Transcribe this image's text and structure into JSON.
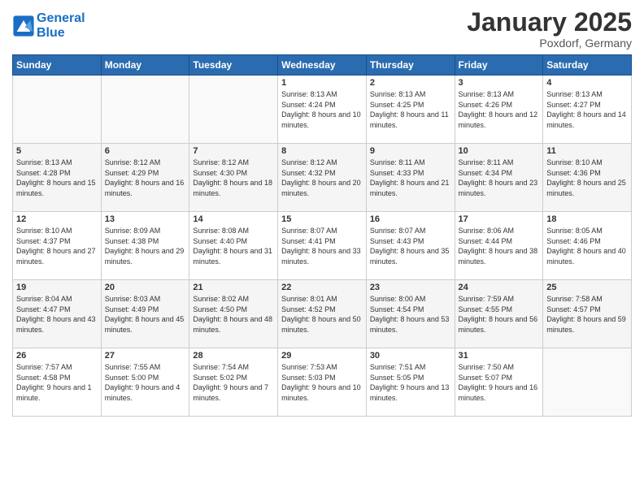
{
  "header": {
    "logo_line1": "General",
    "logo_line2": "Blue",
    "month_title": "January 2025",
    "location": "Poxdorf, Germany"
  },
  "weekdays": [
    "Sunday",
    "Monday",
    "Tuesday",
    "Wednesday",
    "Thursday",
    "Friday",
    "Saturday"
  ],
  "weeks": [
    [
      {
        "day": "",
        "sunrise": "",
        "sunset": "",
        "daylight": ""
      },
      {
        "day": "",
        "sunrise": "",
        "sunset": "",
        "daylight": ""
      },
      {
        "day": "",
        "sunrise": "",
        "sunset": "",
        "daylight": ""
      },
      {
        "day": "1",
        "sunrise": "Sunrise: 8:13 AM",
        "sunset": "Sunset: 4:24 PM",
        "daylight": "Daylight: 8 hours and 10 minutes."
      },
      {
        "day": "2",
        "sunrise": "Sunrise: 8:13 AM",
        "sunset": "Sunset: 4:25 PM",
        "daylight": "Daylight: 8 hours and 11 minutes."
      },
      {
        "day": "3",
        "sunrise": "Sunrise: 8:13 AM",
        "sunset": "Sunset: 4:26 PM",
        "daylight": "Daylight: 8 hours and 12 minutes."
      },
      {
        "day": "4",
        "sunrise": "Sunrise: 8:13 AM",
        "sunset": "Sunset: 4:27 PM",
        "daylight": "Daylight: 8 hours and 14 minutes."
      }
    ],
    [
      {
        "day": "5",
        "sunrise": "Sunrise: 8:13 AM",
        "sunset": "Sunset: 4:28 PM",
        "daylight": "Daylight: 8 hours and 15 minutes."
      },
      {
        "day": "6",
        "sunrise": "Sunrise: 8:12 AM",
        "sunset": "Sunset: 4:29 PM",
        "daylight": "Daylight: 8 hours and 16 minutes."
      },
      {
        "day": "7",
        "sunrise": "Sunrise: 8:12 AM",
        "sunset": "Sunset: 4:30 PM",
        "daylight": "Daylight: 8 hours and 18 minutes."
      },
      {
        "day": "8",
        "sunrise": "Sunrise: 8:12 AM",
        "sunset": "Sunset: 4:32 PM",
        "daylight": "Daylight: 8 hours and 20 minutes."
      },
      {
        "day": "9",
        "sunrise": "Sunrise: 8:11 AM",
        "sunset": "Sunset: 4:33 PM",
        "daylight": "Daylight: 8 hours and 21 minutes."
      },
      {
        "day": "10",
        "sunrise": "Sunrise: 8:11 AM",
        "sunset": "Sunset: 4:34 PM",
        "daylight": "Daylight: 8 hours and 23 minutes."
      },
      {
        "day": "11",
        "sunrise": "Sunrise: 8:10 AM",
        "sunset": "Sunset: 4:36 PM",
        "daylight": "Daylight: 8 hours and 25 minutes."
      }
    ],
    [
      {
        "day": "12",
        "sunrise": "Sunrise: 8:10 AM",
        "sunset": "Sunset: 4:37 PM",
        "daylight": "Daylight: 8 hours and 27 minutes."
      },
      {
        "day": "13",
        "sunrise": "Sunrise: 8:09 AM",
        "sunset": "Sunset: 4:38 PM",
        "daylight": "Daylight: 8 hours and 29 minutes."
      },
      {
        "day": "14",
        "sunrise": "Sunrise: 8:08 AM",
        "sunset": "Sunset: 4:40 PM",
        "daylight": "Daylight: 8 hours and 31 minutes."
      },
      {
        "day": "15",
        "sunrise": "Sunrise: 8:07 AM",
        "sunset": "Sunset: 4:41 PM",
        "daylight": "Daylight: 8 hours and 33 minutes."
      },
      {
        "day": "16",
        "sunrise": "Sunrise: 8:07 AM",
        "sunset": "Sunset: 4:43 PM",
        "daylight": "Daylight: 8 hours and 35 minutes."
      },
      {
        "day": "17",
        "sunrise": "Sunrise: 8:06 AM",
        "sunset": "Sunset: 4:44 PM",
        "daylight": "Daylight: 8 hours and 38 minutes."
      },
      {
        "day": "18",
        "sunrise": "Sunrise: 8:05 AM",
        "sunset": "Sunset: 4:46 PM",
        "daylight": "Daylight: 8 hours and 40 minutes."
      }
    ],
    [
      {
        "day": "19",
        "sunrise": "Sunrise: 8:04 AM",
        "sunset": "Sunset: 4:47 PM",
        "daylight": "Daylight: 8 hours and 43 minutes."
      },
      {
        "day": "20",
        "sunrise": "Sunrise: 8:03 AM",
        "sunset": "Sunset: 4:49 PM",
        "daylight": "Daylight: 8 hours and 45 minutes."
      },
      {
        "day": "21",
        "sunrise": "Sunrise: 8:02 AM",
        "sunset": "Sunset: 4:50 PM",
        "daylight": "Daylight: 8 hours and 48 minutes."
      },
      {
        "day": "22",
        "sunrise": "Sunrise: 8:01 AM",
        "sunset": "Sunset: 4:52 PM",
        "daylight": "Daylight: 8 hours and 50 minutes."
      },
      {
        "day": "23",
        "sunrise": "Sunrise: 8:00 AM",
        "sunset": "Sunset: 4:54 PM",
        "daylight": "Daylight: 8 hours and 53 minutes."
      },
      {
        "day": "24",
        "sunrise": "Sunrise: 7:59 AM",
        "sunset": "Sunset: 4:55 PM",
        "daylight": "Daylight: 8 hours and 56 minutes."
      },
      {
        "day": "25",
        "sunrise": "Sunrise: 7:58 AM",
        "sunset": "Sunset: 4:57 PM",
        "daylight": "Daylight: 8 hours and 59 minutes."
      }
    ],
    [
      {
        "day": "26",
        "sunrise": "Sunrise: 7:57 AM",
        "sunset": "Sunset: 4:58 PM",
        "daylight": "Daylight: 9 hours and 1 minute."
      },
      {
        "day": "27",
        "sunrise": "Sunrise: 7:55 AM",
        "sunset": "Sunset: 5:00 PM",
        "daylight": "Daylight: 9 hours and 4 minutes."
      },
      {
        "day": "28",
        "sunrise": "Sunrise: 7:54 AM",
        "sunset": "Sunset: 5:02 PM",
        "daylight": "Daylight: 9 hours and 7 minutes."
      },
      {
        "day": "29",
        "sunrise": "Sunrise: 7:53 AM",
        "sunset": "Sunset: 5:03 PM",
        "daylight": "Daylight: 9 hours and 10 minutes."
      },
      {
        "day": "30",
        "sunrise": "Sunrise: 7:51 AM",
        "sunset": "Sunset: 5:05 PM",
        "daylight": "Daylight: 9 hours and 13 minutes."
      },
      {
        "day": "31",
        "sunrise": "Sunrise: 7:50 AM",
        "sunset": "Sunset: 5:07 PM",
        "daylight": "Daylight: 9 hours and 16 minutes."
      },
      {
        "day": "",
        "sunrise": "",
        "sunset": "",
        "daylight": ""
      }
    ]
  ]
}
